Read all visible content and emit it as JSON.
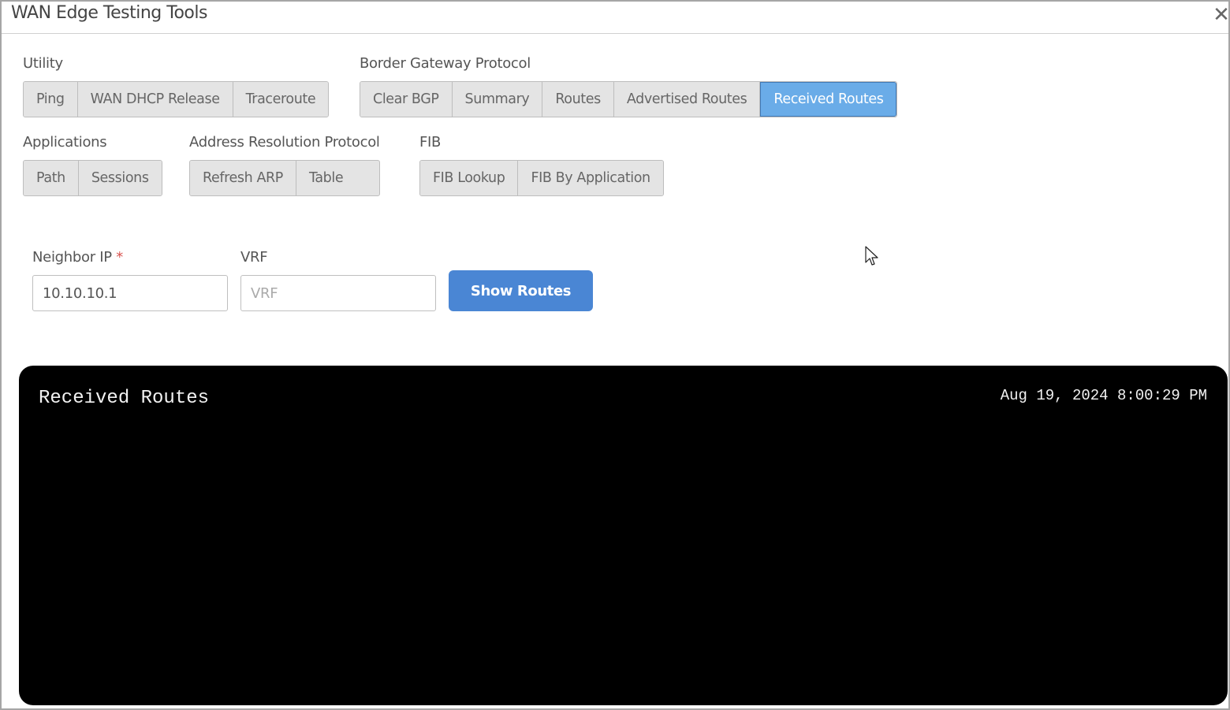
{
  "modal": {
    "title": "WAN Edge Testing Tools",
    "close_icon": "close-icon"
  },
  "groups": {
    "utility": {
      "label": "Utility",
      "buttons": [
        "Ping",
        "WAN DHCP Release",
        "Traceroute"
      ]
    },
    "bgp": {
      "label": "Border Gateway Protocol",
      "buttons": [
        "Clear BGP",
        "Summary",
        "Routes",
        "Advertised Routes",
        "Received Routes"
      ],
      "active": "Received Routes"
    },
    "applications": {
      "label": "Applications",
      "buttons": [
        "Path",
        "Sessions"
      ]
    },
    "arp": {
      "label": "Address Resolution Protocol",
      "buttons": [
        "Refresh ARP",
        "Table"
      ]
    },
    "fib": {
      "label": "FIB",
      "buttons": [
        "FIB Lookup",
        "FIB By Application"
      ]
    }
  },
  "form": {
    "neighbor_ip_label": "Neighbor IP",
    "required_mark": "*",
    "neighbor_ip_value": "10.10.10.1",
    "vrf_label": "VRF",
    "vrf_placeholder": "VRF",
    "vrf_value": "",
    "submit_label": "Show Routes"
  },
  "output": {
    "title": "Received Routes",
    "timestamp": "Aug 19, 2024 8:00:29 PM"
  },
  "colors": {
    "active_tab": "#6aace8",
    "primary_button": "#4a86d4",
    "required": "#d9534f",
    "terminal_bg": "#000000"
  }
}
